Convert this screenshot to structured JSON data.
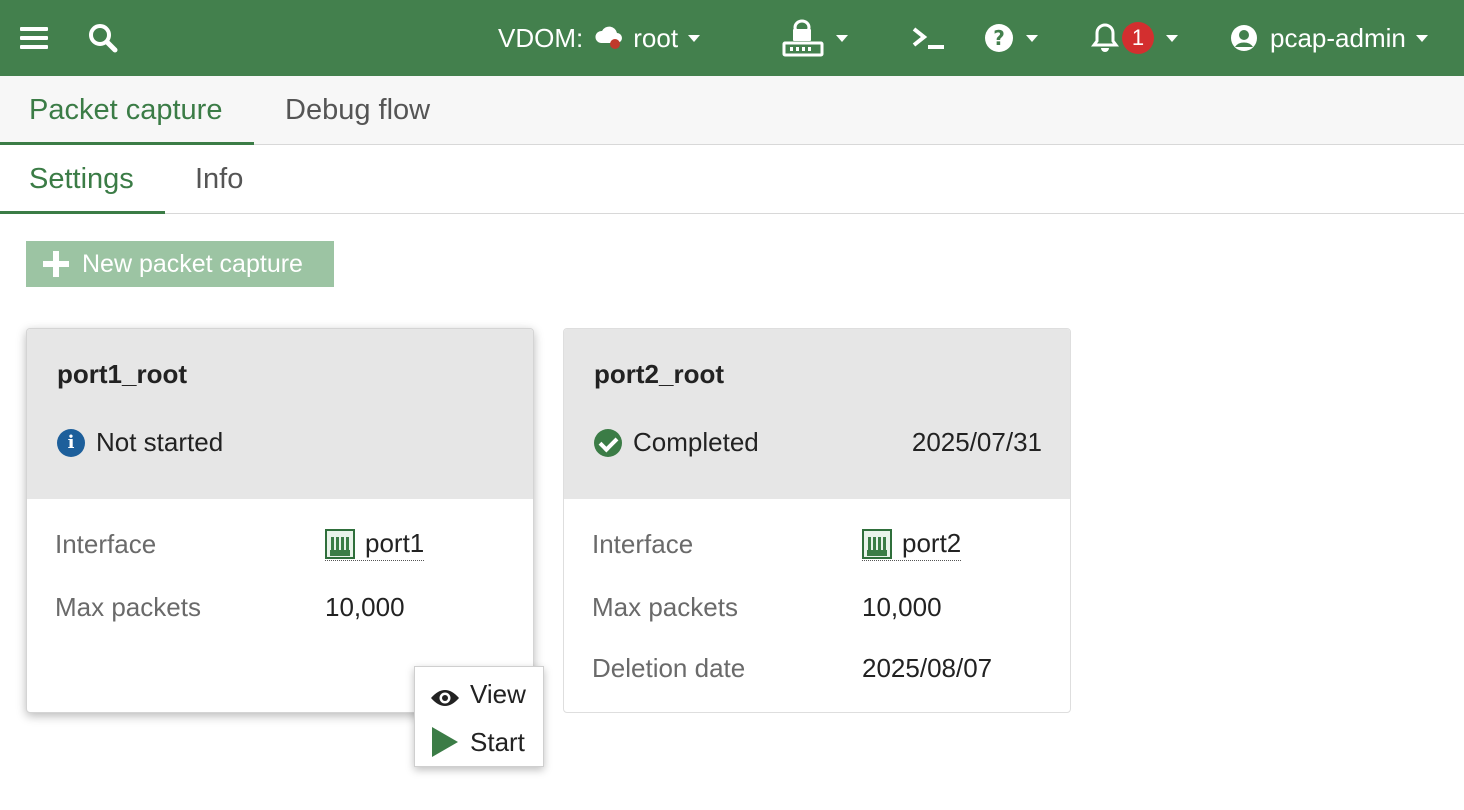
{
  "header": {
    "vdom_label": "VDOM:",
    "vdom_value": "root",
    "notification_count": "1",
    "user": "pcap-admin",
    "colors": {
      "bar": "#43804d",
      "badge": "#d32f2f"
    },
    "icons": [
      "menu-icon",
      "search-icon",
      "vdom-icon",
      "device-lock-icon",
      "terminal-icon",
      "help-icon",
      "bell-icon",
      "user-icon"
    ]
  },
  "tabs": {
    "primary": [
      {
        "label": "Packet capture",
        "active": true
      },
      {
        "label": "Debug flow",
        "active": false
      }
    ],
    "secondary": [
      {
        "label": "Settings",
        "active": true
      },
      {
        "label": "Info",
        "active": false
      }
    ]
  },
  "toolbar": {
    "new_label": "New packet capture"
  },
  "cards": [
    {
      "name": "port1_root",
      "status": "Not started",
      "status_icon": "info-icon",
      "interface_label": "Interface",
      "interface": "port1",
      "max_packets_label": "Max packets",
      "max_packets": "10,000"
    },
    {
      "name": "port2_root",
      "status": "Completed",
      "status_icon": "check-circle-icon",
      "status_date": "2025/07/31",
      "interface_label": "Interface",
      "interface": "port2",
      "max_packets_label": "Max packets",
      "max_packets": "10,000",
      "deletion_label": "Deletion date",
      "deletion_date": "2025/08/07"
    }
  ],
  "context_menu": {
    "items": [
      {
        "label": "View",
        "icon": "eye-icon"
      },
      {
        "label": "Start",
        "icon": "play-icon"
      }
    ]
  }
}
